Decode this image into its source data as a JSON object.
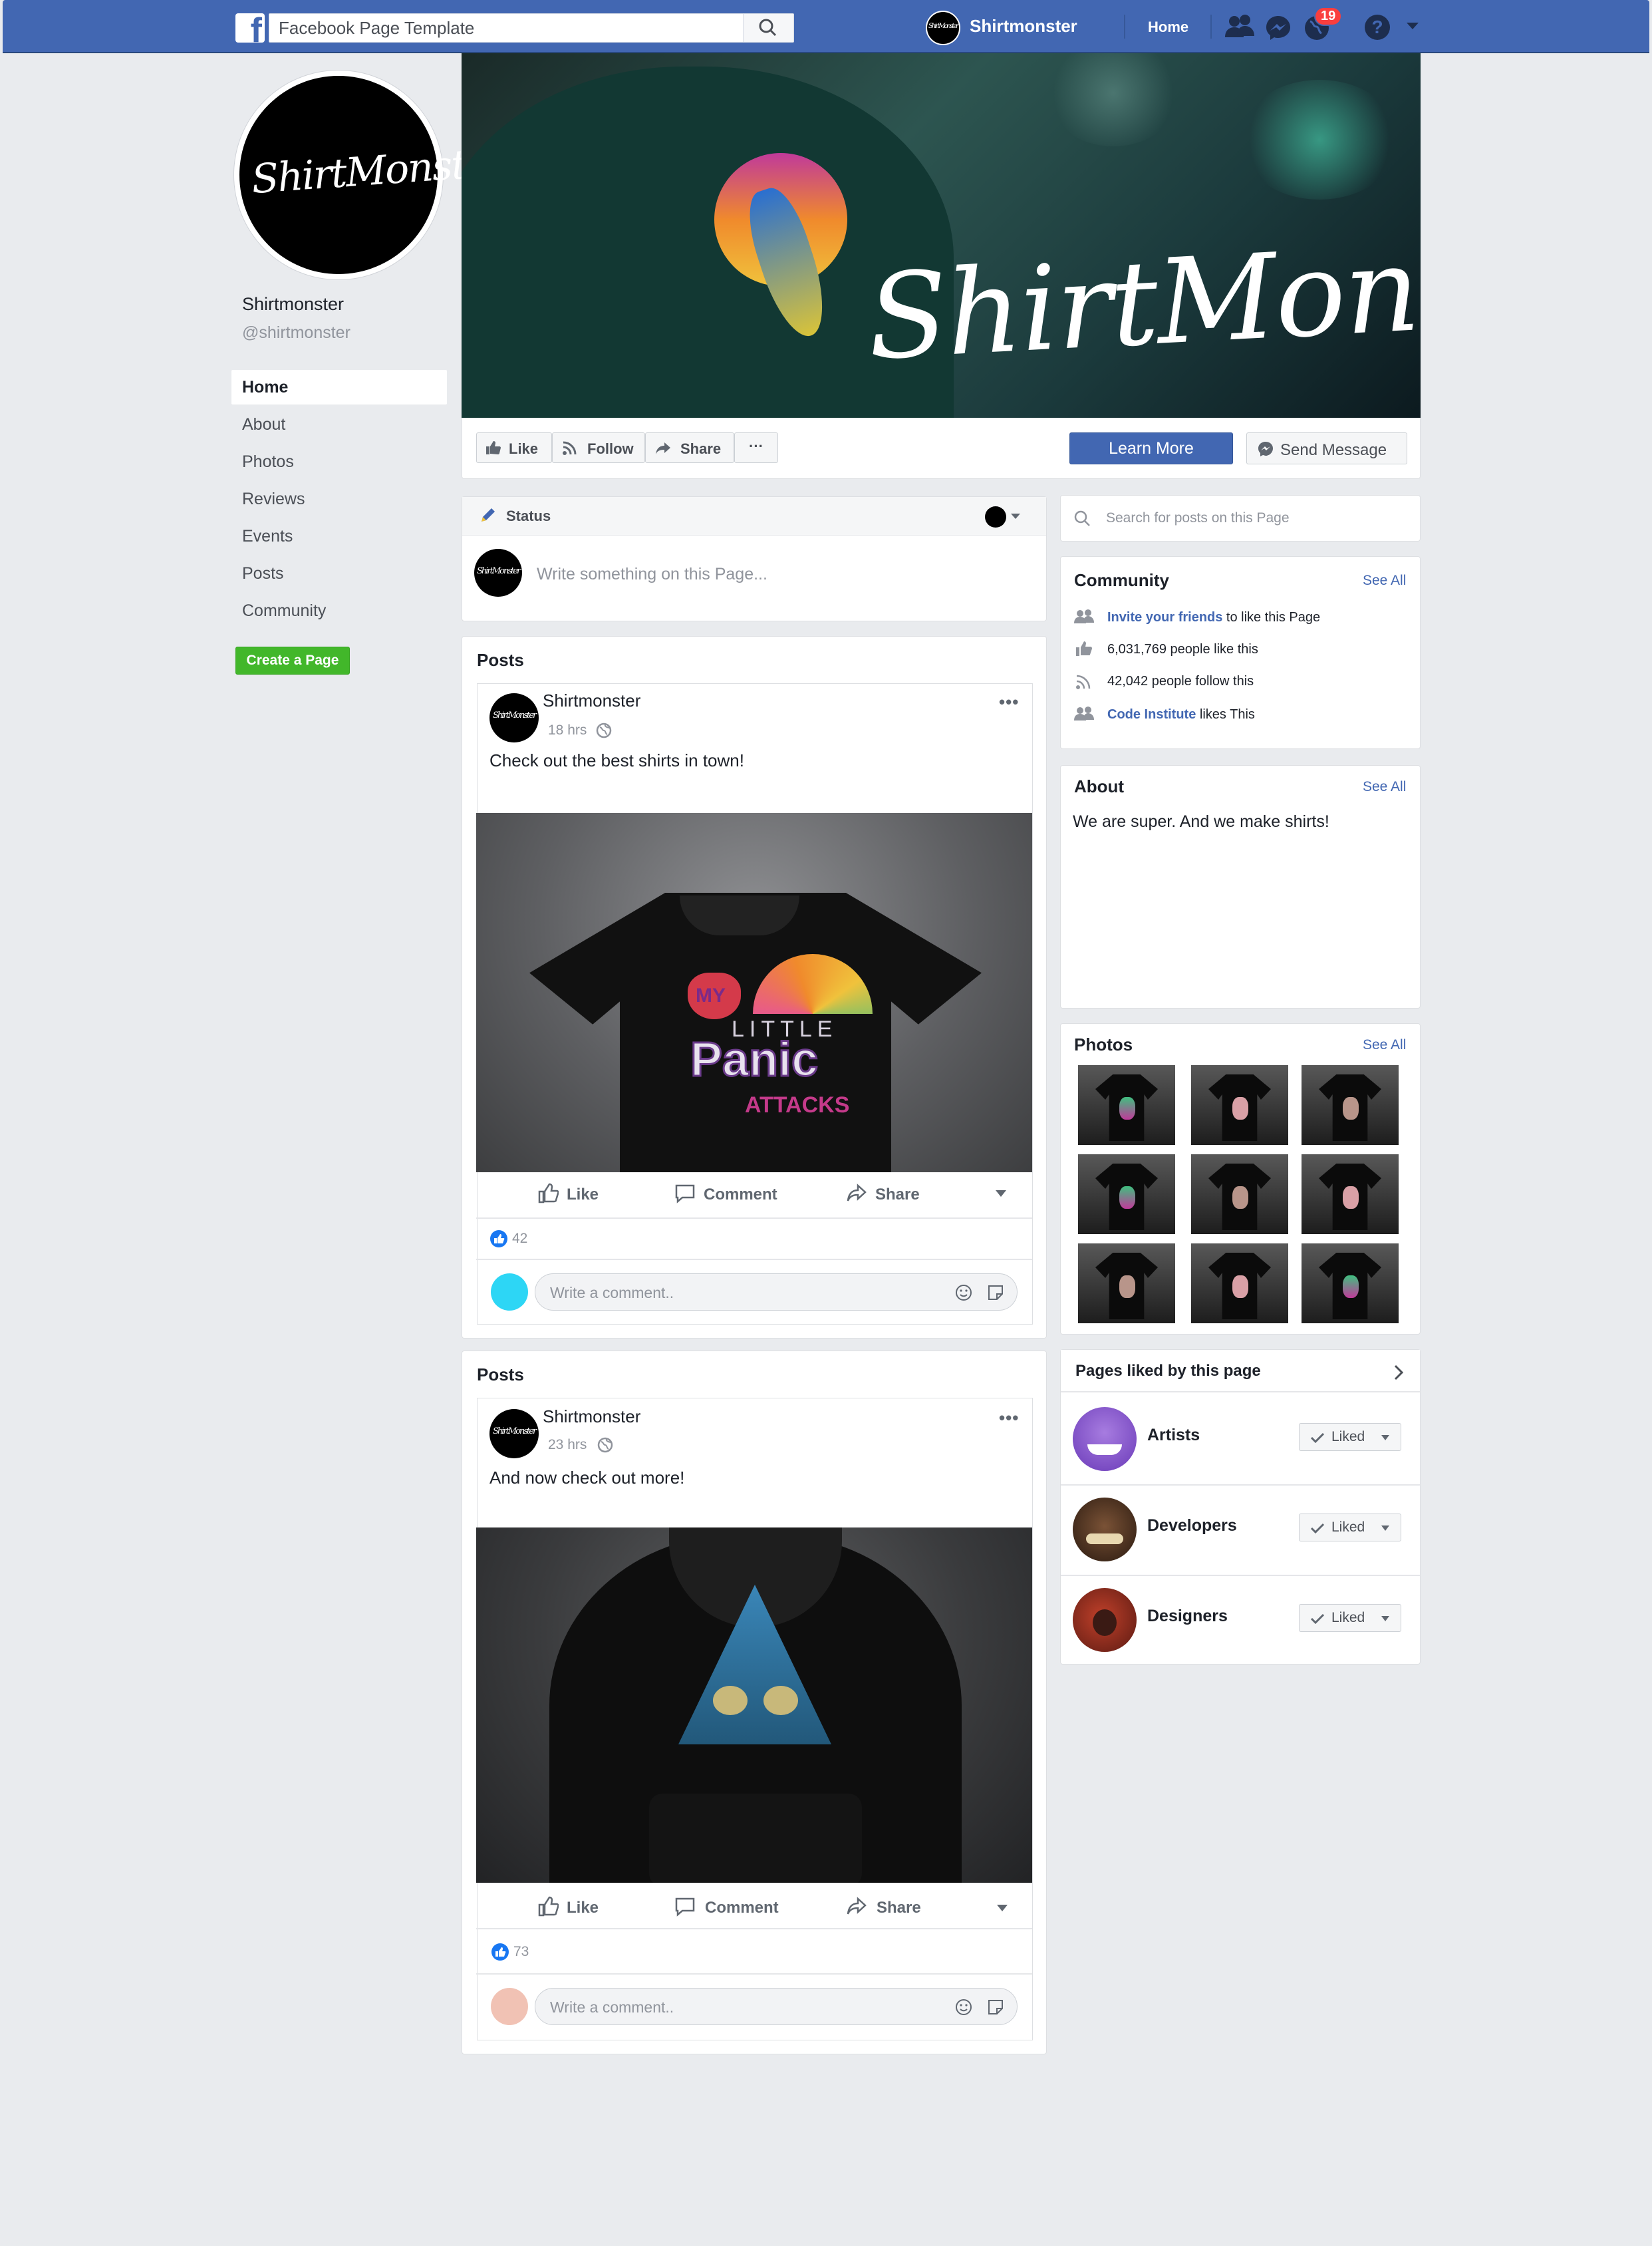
{
  "topbar": {
    "logo_letter": "f",
    "search_placeholder": "Facebook Page Template",
    "profile_name": "Shirtmonster",
    "home_label": "Home",
    "notifications_count": "19",
    "help_label": "?"
  },
  "page": {
    "name": "Shirtmonster",
    "handle": "@shirtmonster",
    "brand_lettering": "ShirtMonster"
  },
  "left_nav": {
    "items": [
      "Home",
      "About",
      "Photos",
      "Reviews",
      "Events",
      "Posts",
      "Community"
    ],
    "create_page": "Create a Page"
  },
  "action_bar": {
    "like": "Like",
    "follow": "Follow",
    "share": "Share",
    "more": "···",
    "learn_more": "Learn More",
    "send_message": "Send Message"
  },
  "composer": {
    "status_label": "Status",
    "placeholder": "Write something on this Page..."
  },
  "posts": [
    {
      "section_title": "Posts",
      "author": "Shirtmonster",
      "time": "18 hrs",
      "text": "Check out the best shirts in town!",
      "like_label": "Like",
      "comment_label": "Comment",
      "share_label": "Share",
      "reaction_count": "42",
      "comment_placeholder": "Write a comment..",
      "comment_avatar_color": "#2dd6f5",
      "image_text": [
        "MY",
        "LITTLE",
        "Panic",
        "ATTACKS"
      ]
    },
    {
      "section_title": "Posts",
      "author": "Shirtmonster",
      "time": "23 hrs",
      "text": "And now check out more!",
      "like_label": "Like",
      "comment_label": "Comment",
      "share_label": "Share",
      "reaction_count": "73",
      "comment_placeholder": "Write a comment..",
      "comment_avatar_color": "#f1c2b4"
    }
  ],
  "right": {
    "search_placeholder": "Search for posts on this Page",
    "community": {
      "title": "Community",
      "see_all": "See All",
      "invite_link": "Invite your friends",
      "invite_rest": " to like this Page",
      "likes": "6,031,769 people like this",
      "follows": "42,042 people follow this",
      "friend_link": "Code Institute",
      "friend_rest": " likes This"
    },
    "about": {
      "title": "About",
      "see_all": "See All",
      "text": "We are super. And we make shirts!"
    },
    "photos": {
      "title": "Photos",
      "see_all": "See All"
    },
    "pages_liked": {
      "title": "Pages liked by this page",
      "items": [
        {
          "name": "Artists",
          "button": "Liked"
        },
        {
          "name": "Developers",
          "button": "Liked"
        },
        {
          "name": "Designers",
          "button": "Liked"
        }
      ]
    }
  },
  "colors": {
    "facebook_blue": "#4267b2",
    "create_page_green": "#42b72a",
    "link_blue": "#4267b2",
    "like_reaction": "#1877f2"
  }
}
